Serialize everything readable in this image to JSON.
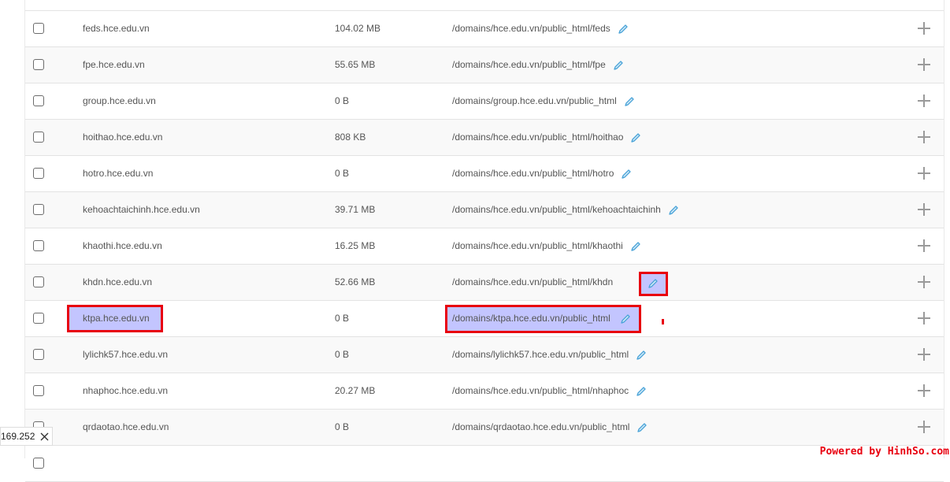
{
  "rows": [
    {
      "domain": "feds.hce.edu.vn",
      "size": "104.02 MB",
      "path": "/domains/hce.edu.vn/public_html/feds"
    },
    {
      "domain": "fpe.hce.edu.vn",
      "size": "55.65 MB",
      "path": "/domains/hce.edu.vn/public_html/fpe"
    },
    {
      "domain": "group.hce.edu.vn",
      "size": "0 B",
      "path": "/domains/group.hce.edu.vn/public_html"
    },
    {
      "domain": "hoithao.hce.edu.vn",
      "size": "808 KB",
      "path": "/domains/hce.edu.vn/public_html/hoithao"
    },
    {
      "domain": "hotro.hce.edu.vn",
      "size": "0 B",
      "path": "/domains/hce.edu.vn/public_html/hotro"
    },
    {
      "domain": "kehoachtaichinh.hce.edu.vn",
      "size": "39.71 MB",
      "path": "/domains/hce.edu.vn/public_html/kehoachtaichinh"
    },
    {
      "domain": "khaothi.hce.edu.vn",
      "size": "16.25 MB",
      "path": "/domains/hce.edu.vn/public_html/khaothi"
    },
    {
      "domain": "khdn.hce.edu.vn",
      "size": "52.66 MB",
      "path": "/domains/hce.edu.vn/public_html/khdn"
    },
    {
      "domain": "ktpa.hce.edu.vn",
      "size": "0 B",
      "path": "/domains/ktpa.hce.edu.vn/public_html"
    },
    {
      "domain": "lylichk57.hce.edu.vn",
      "size": "0 B",
      "path": "/domains/lylichk57.hce.edu.vn/public_html"
    },
    {
      "domain": "nhaphoc.hce.edu.vn",
      "size": "20.27 MB",
      "path": "/domains/hce.edu.vn/public_html/nhaphoc"
    },
    {
      "domain": "qrdaotao.hce.edu.vn",
      "size": "0 B",
      "path": "/domains/qrdaotao.hce.edu.vn/public_html"
    }
  ],
  "tooltip": {
    "text": "169.252",
    "close_icon": "close-icon"
  },
  "watermark": {
    "text": "Powered by HinhSo.com"
  },
  "colors": {
    "highlight": "#c3c5ff",
    "highlight_border": "#e8000f",
    "pencil": "#4aa3d8",
    "plus": "#9a9a9a"
  },
  "icons": {
    "edit": "pencil-icon",
    "add": "plus-icon"
  }
}
